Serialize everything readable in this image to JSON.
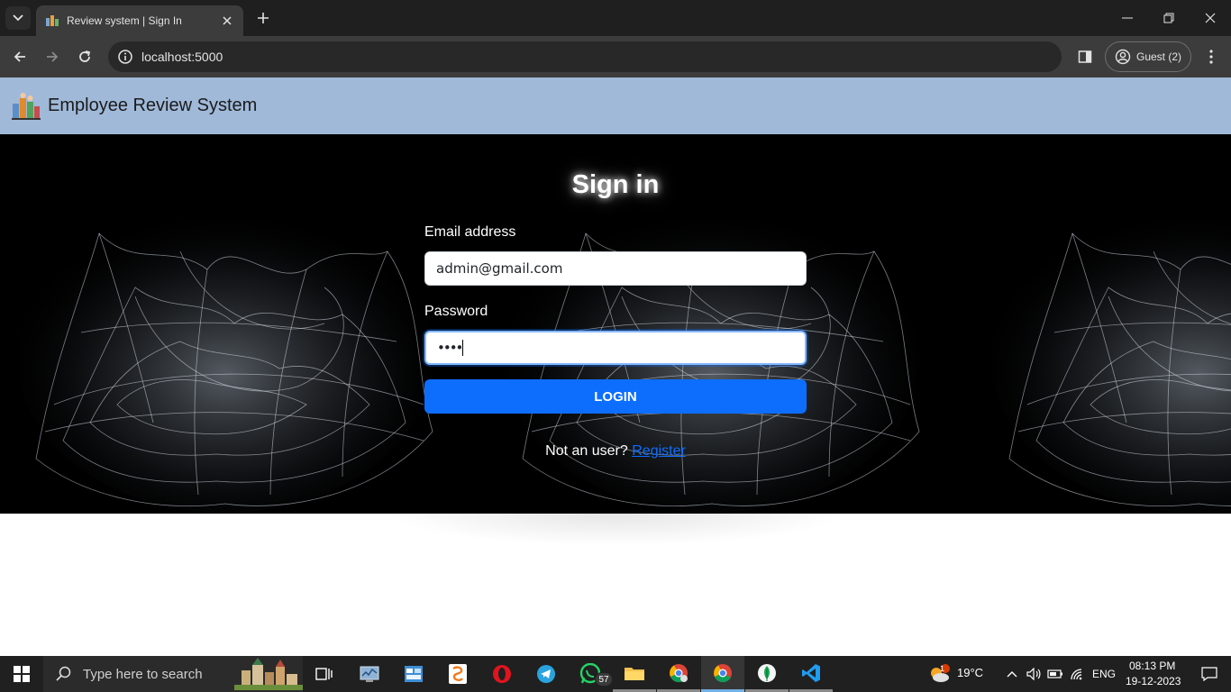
{
  "browser": {
    "tab_title": "Review system | Sign In",
    "url": "localhost:5000",
    "profile_label": "Guest (2)"
  },
  "navbar": {
    "brand": "Employee Review System"
  },
  "signin": {
    "title": "Sign in",
    "email_label": "Email address",
    "email_value": "admin@gmail.com",
    "password_label": "Password",
    "password_value": "••••",
    "login_button": "LOGIN",
    "register_prompt": "Not an user?",
    "register_link": "Register"
  },
  "taskbar": {
    "search_placeholder": "Type here to search",
    "whatsapp_badge": "57",
    "weather_badge": "1",
    "temperature": "19°C",
    "language": "ENG",
    "time": "08:13 PM",
    "date": "19-12-2023"
  },
  "colors": {
    "navbar_bg": "#a0b9d9",
    "primary": "#0d6efd",
    "hero_bg": "#000000"
  }
}
